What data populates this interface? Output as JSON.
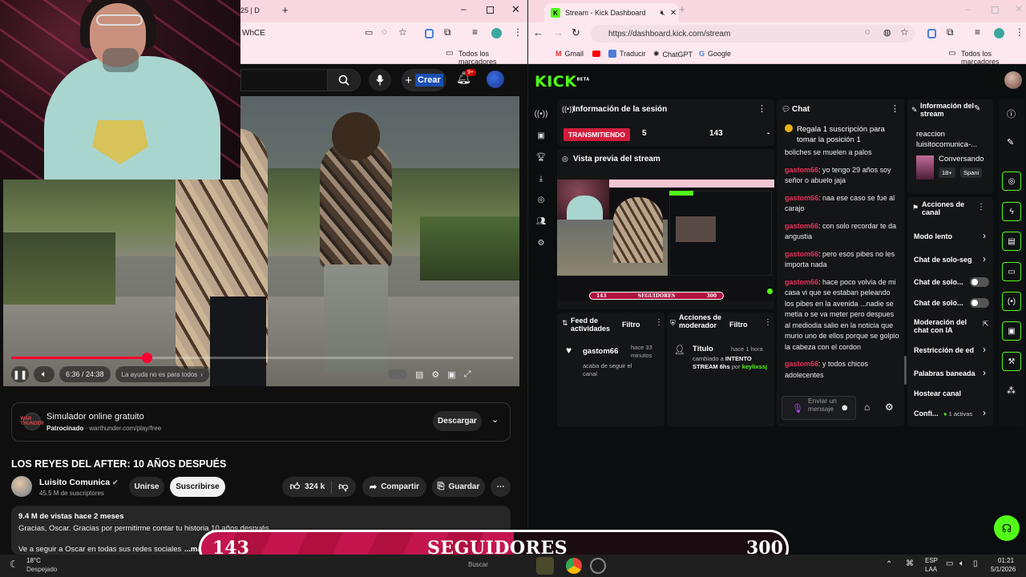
{
  "left_browser": {
    "tab_fragment": "25 | D",
    "address_fragment": "WhCE",
    "bookmarks_all": "Todos los marcadores"
  },
  "youtube": {
    "create_label": "Crear",
    "notif_count": "9+",
    "player": {
      "time": "6:36 / 24:38",
      "caption_chip": "La ayuda no es para todos",
      "progress_fraction": 0.27
    },
    "ad": {
      "logo_text": "WAR THUNDER",
      "title": "Simulador online gratuito",
      "sponsored": "Patrocinado",
      "domain": "warthunder.com/play/free",
      "cta": "Descargar"
    },
    "video_title": "LOS REYES DEL AFTER: 10 AÑOS DESPUÉS",
    "channel": {
      "name": "Luisito Comunica",
      "subs": "45.5 M de suscriptores",
      "join": "Unirse",
      "subscribe": "Suscribirse"
    },
    "actions": {
      "likes": "324 k",
      "share": "Compartir",
      "save": "Guardar"
    },
    "description": {
      "stats": "9.4 M de vistas  hace 2 meses",
      "line1": "Gracias, Oscar. Gracias por permitirme contar tu historia 10 años después",
      "line2": "Ve a seguir a Oscar en todas sus redes sociales",
      "more": "...más"
    }
  },
  "right_browser": {
    "tab_title": "Stream - Kick Dashboard",
    "url": "https://dashboard.kick.com/stream",
    "bookmarks": [
      "Gmail",
      "Traducir",
      "ChatGPT",
      "Google"
    ],
    "bookmarks_all": "Todos los marcadores"
  },
  "kick": {
    "logo": "KICK",
    "logo_beta": "BETA",
    "session": {
      "title": "Información de la sesión",
      "status": "TRANSMITIENDO",
      "viewers": "5",
      "followers": "143",
      "third": "-"
    },
    "preview": {
      "title": "Vista previa del stream"
    },
    "feed": {
      "title": "Feed de actividades",
      "filter": "Filtro",
      "user": "gastom66",
      "time": "hace 33 minutos",
      "action": "acaba de seguir el canal"
    },
    "mod_actions": {
      "title": "Acciones de moderador",
      "filter": "Filtro",
      "item_title": "Título",
      "time": "hace 1 hora",
      "changed": "cambiado a",
      "new_title": "INTENTO STREAM 6hs",
      "by": "por",
      "user": "keylixssj"
    },
    "chat": {
      "title": "Chat",
      "pinned": "Regala 1 suscripción para tomar la posición 1",
      "messages": [
        {
          "user": "",
          "text": "boliches se muelen a palos"
        },
        {
          "user": "gastom66",
          "text": ": yo tengo 29 años soy señor o abuelo jaja"
        },
        {
          "user": "gastom66",
          "text": ": naa ese caso se fue al carajo"
        },
        {
          "user": "gastom66",
          "text": ": con solo recordar te da angustia"
        },
        {
          "user": "gastom66",
          "text": ": pero esos pibes no les importa nada"
        },
        {
          "user": "gastom66",
          "text": ": hace poco volvia de mi casa vi que se estaban peleando los pibes en la avenida ...nadie se metia o se va meter pero despues al mediodia salio en la noticia que murio uno de ellos porque se golpio la cabeza con el cordon"
        },
        {
          "user": "gastom66",
          "text": ": y todos chicos adolecentes"
        }
      ],
      "input_placeholder": "Enviar un mensaje"
    },
    "stream_info": {
      "title": "Información del stream",
      "stream_title": "reaccion luisitocomunica-...",
      "category": "Conversando",
      "tag1": "18+",
      "tag2": "Spani"
    },
    "channel_actions": {
      "title": "Acciones de canal",
      "items": [
        "Modo lento",
        "Chat de solo-seg",
        "Chat de solo...",
        "Chat de solo...",
        "Moderación del chat con IA",
        "Restricción de ed",
        "Palabras baneada",
        "Hostear canal",
        "Confi..."
      ],
      "active_badge": "1 activas"
    }
  },
  "overlay": {
    "current": "143",
    "label": "SEGUIDORES",
    "goal": "300",
    "goal_fraction": 0.477
  },
  "taskbar": {
    "temp": "18°C",
    "weather": "Despejado",
    "search": "Buscar",
    "lang1": "ESP",
    "lang2": "LAA",
    "time": "01:21",
    "date": "5/1/2026"
  }
}
